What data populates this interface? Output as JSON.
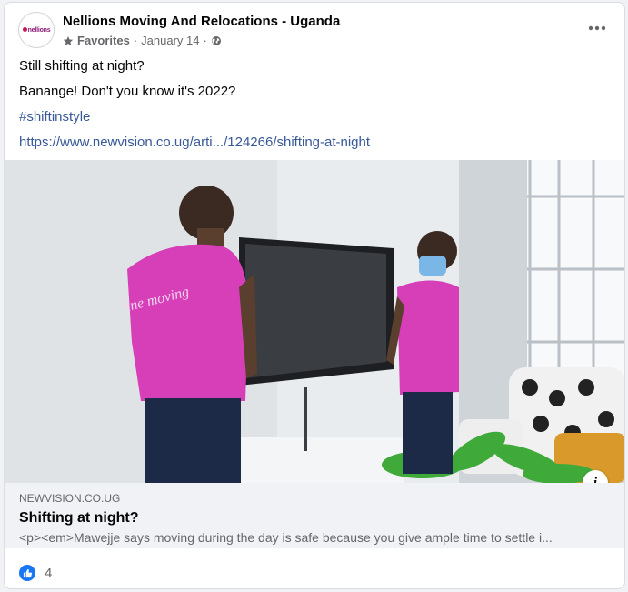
{
  "post": {
    "page_name": "Nellions Moving And Relocations - Uganda",
    "avatar_logo_text": "nellions",
    "meta": {
      "favorites": "Favorites",
      "separator": "·",
      "date": "January 14",
      "separator2": "·"
    },
    "text": {
      "line1": "Still shifting at night?",
      "line2": "Banange! Don't you know it's 2022?",
      "hashtag": "#shiftinstyle",
      "link": "https://www.newvision.co.ug/arti.../124266/shifting-at-night"
    },
    "preview": {
      "shirt_text": "fine moving",
      "domain": "NEWVISION.CO.UG",
      "title": "Shifting at night?",
      "description": "<p><em>Mawejje says moving during the day is safe because you give ample time to settle i...",
      "info_label": "i"
    },
    "reactions": {
      "count": "4"
    }
  },
  "colors": {
    "link": "#385898",
    "like": "#1877f2",
    "shirt": "#d63fb8"
  }
}
